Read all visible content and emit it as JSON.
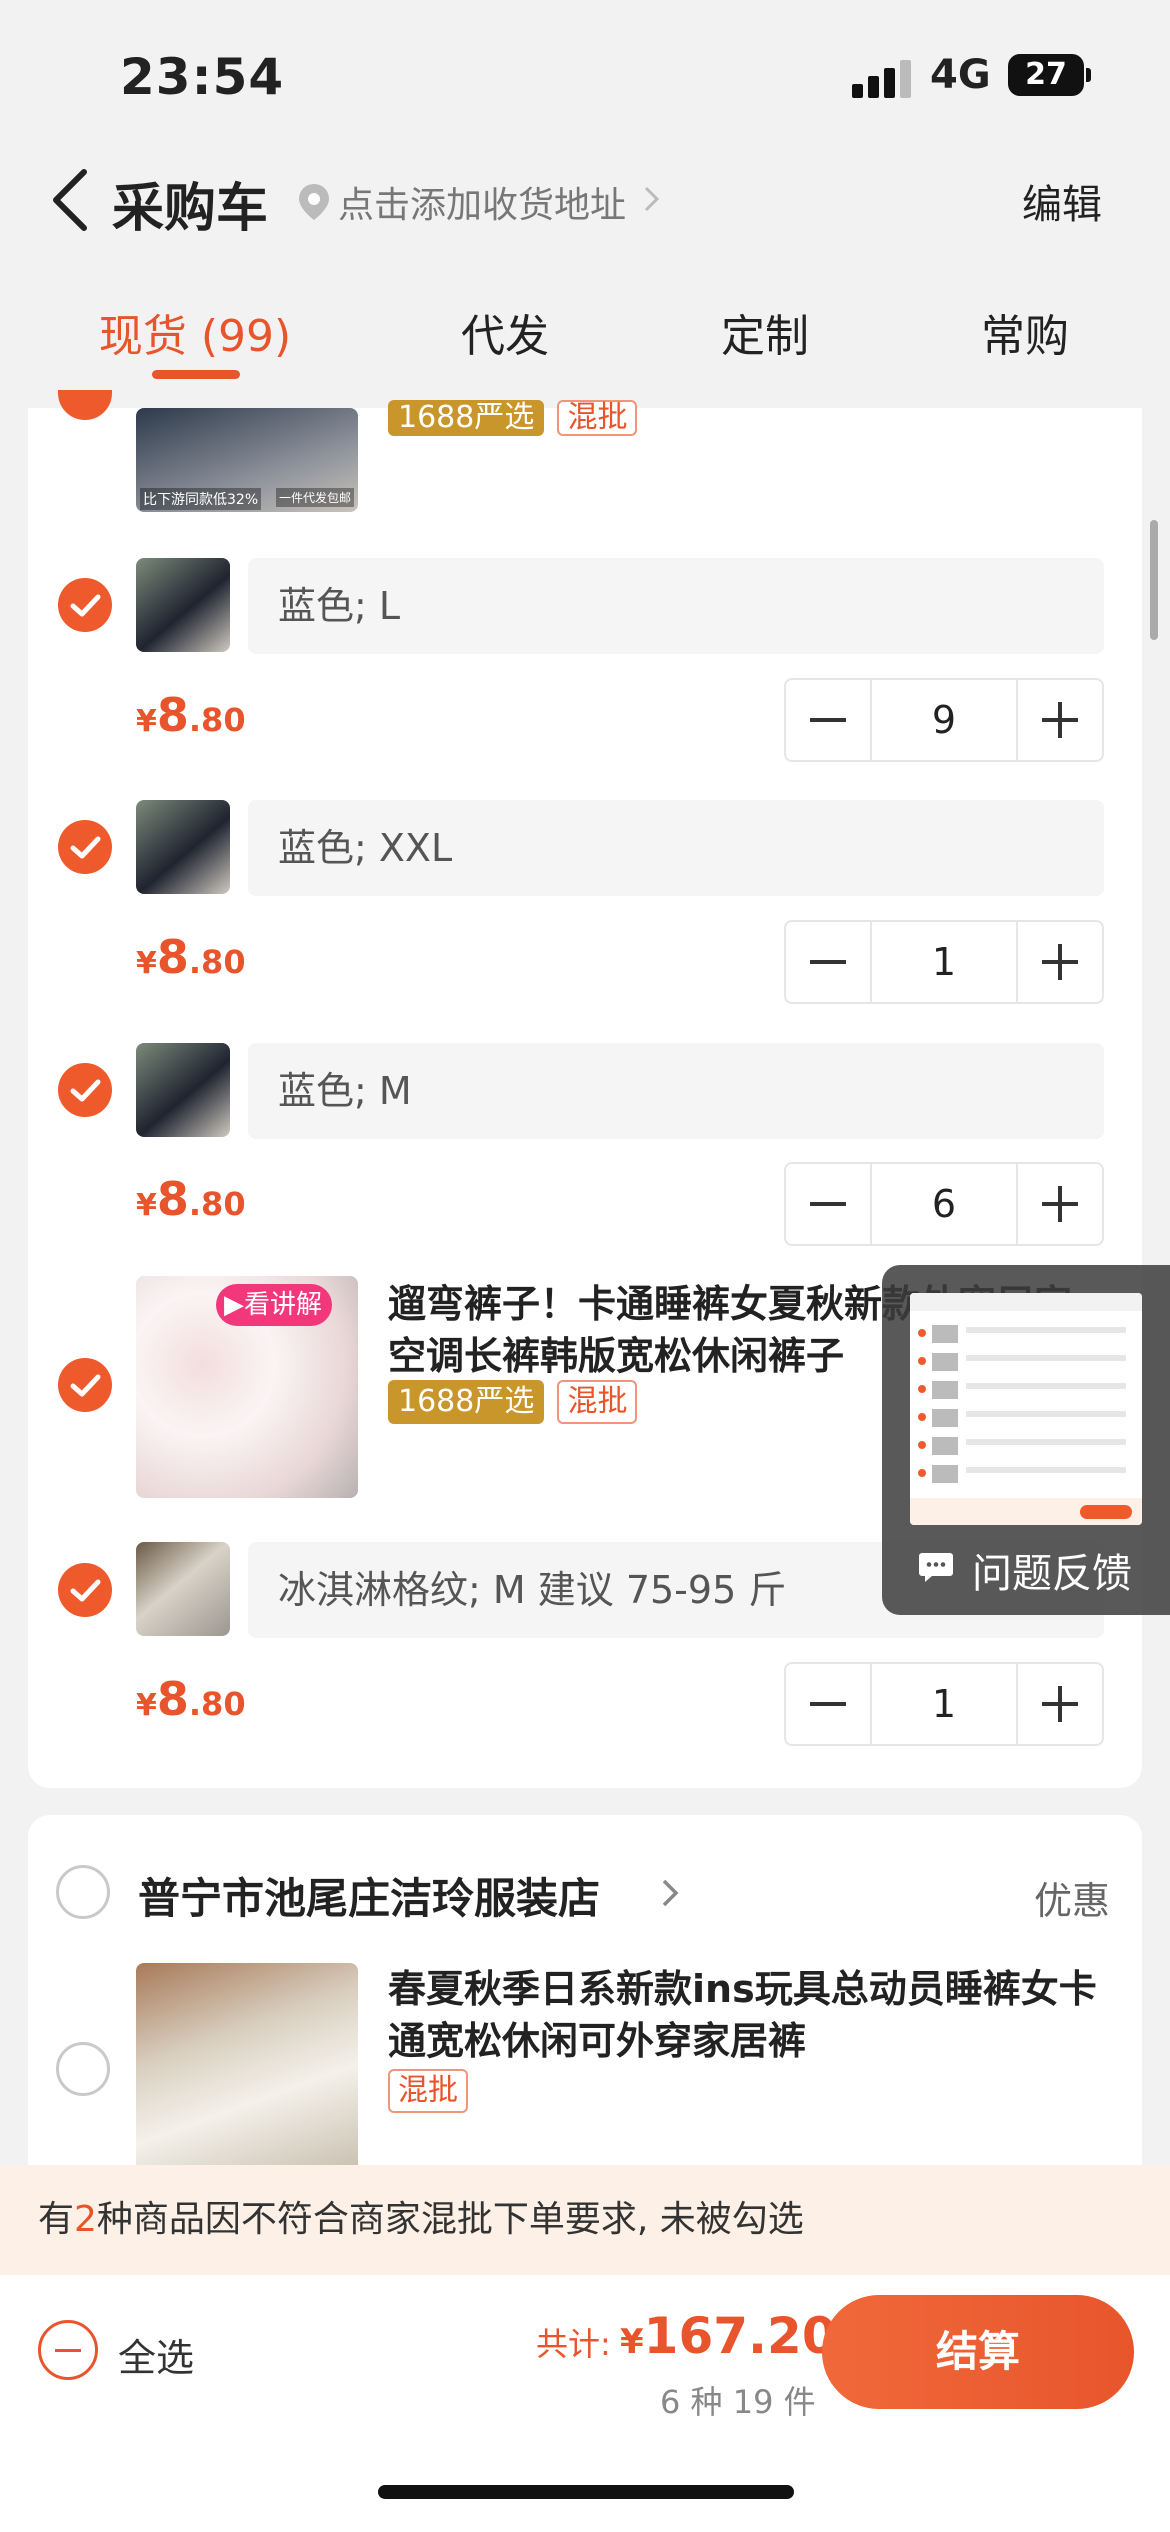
{
  "status_bar": {
    "time": "23:54",
    "network": "4G",
    "battery": "27"
  },
  "nav": {
    "title": "采购车",
    "address": "点击添加收货地址",
    "edit": "编辑"
  },
  "tabs": [
    {
      "label": "现货 (99)"
    },
    {
      "label": "代发"
    },
    {
      "label": "定制"
    },
    {
      "label": "常购"
    }
  ],
  "first_product_partial": {
    "badges": {
      "yanxuan": "1688严选",
      "mixed": "混批"
    },
    "image_caption_left": "比下游同款低32%",
    "image_caption_right": "一件代发包邮"
  },
  "variants_a": [
    {
      "label": "蓝色; L",
      "price_symbol": "¥",
      "price_int": "8",
      "price_dec": ".80",
      "qty": "9"
    },
    {
      "label": "蓝色; XXL",
      "price_symbol": "¥",
      "price_int": "8",
      "price_dec": ".80",
      "qty": "1"
    },
    {
      "label": "蓝色; M",
      "price_symbol": "¥",
      "price_int": "8",
      "price_dec": ".80",
      "qty": "6"
    }
  ],
  "product2": {
    "title": "遛弯裤子！卡通睡裤女夏秋新款外穿居家空调长裤韩版宽松休闲裤子",
    "video_tag": "看讲解",
    "badges": {
      "yanxuan": "1688严选",
      "mixed": "混批"
    },
    "variant": {
      "label": "冰淇淋格纹; M 建议 75-95 斤",
      "price_symbol": "¥",
      "price_int": "8",
      "price_dec": ".80",
      "qty": "1"
    }
  },
  "store2": {
    "name": "普宁市池尾庄洁玲服装店",
    "promo": "优惠",
    "product": {
      "title": "春夏秋季日系新款ins玩具总动员睡裤女卡通宽松休闲可外穿家居裤",
      "badge_mixed": "混批"
    }
  },
  "feedback": {
    "label": "问题反馈"
  },
  "notice": {
    "prefix": "有",
    "count": "2",
    "suffix": "种商品因不符合商家混批下单要求, 未被勾选"
  },
  "bottom_bar": {
    "select_all": "全选",
    "total_label": "共计:",
    "total_symbol": "¥",
    "total_amount": "167.20",
    "count": "6 种 19 件",
    "checkout": "结算"
  },
  "colors": {
    "accent": "#e8552c",
    "gold": "#c9962b",
    "notice_bg": "#fdf0e6"
  }
}
